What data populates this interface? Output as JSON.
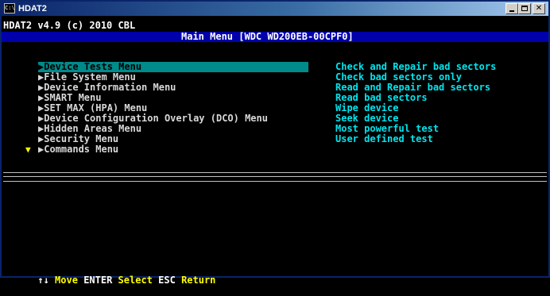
{
  "window": {
    "title": "HDAT2",
    "icon": "console-icon",
    "icon_text": "C:\\"
  },
  "header": {
    "line": "HDAT2 v4.9 (c) 2010 CBL"
  },
  "main_bar": {
    "title": "Main Menu [WDC WD200EB-00CPF0]"
  },
  "menu": [
    {
      "label": "▶Device Tests Menu",
      "selected": true
    },
    {
      "label": "▶File System Menu",
      "selected": false
    },
    {
      "label": "▶Device Information Menu",
      "selected": false
    },
    {
      "label": "▶SMART Menu",
      "selected": false
    },
    {
      "label": "▶SET MAX (HPA) Menu",
      "selected": false
    },
    {
      "label": "▶Device Configuration Overlay (DCO) Menu",
      "selected": false
    },
    {
      "label": "▶Hidden Areas Menu",
      "selected": false
    },
    {
      "label": "▶Security Menu",
      "selected": false
    },
    {
      "label": "▶Commands Menu",
      "selected": false
    }
  ],
  "descriptions": [
    "Check and Repair bad sectors",
    "Check bad sectors only",
    "Read and Repair bad sectors",
    "Read bad sectors",
    "Wipe device",
    "Seek device",
    "Most powerful test",
    "User defined test"
  ],
  "scroll_indicator": "▼",
  "status": [
    {
      "key": "↑↓",
      "action": "Move"
    },
    {
      "key": "ENTER",
      "action": "Select"
    },
    {
      "key": "ESC",
      "action": "Return"
    }
  ],
  "colors": {
    "selection": "#008b8b",
    "menu_text": "#d8d8d8",
    "description_text": "#00e5ee",
    "bar_bg": "#0000aa",
    "status_action": "#ffff00"
  }
}
